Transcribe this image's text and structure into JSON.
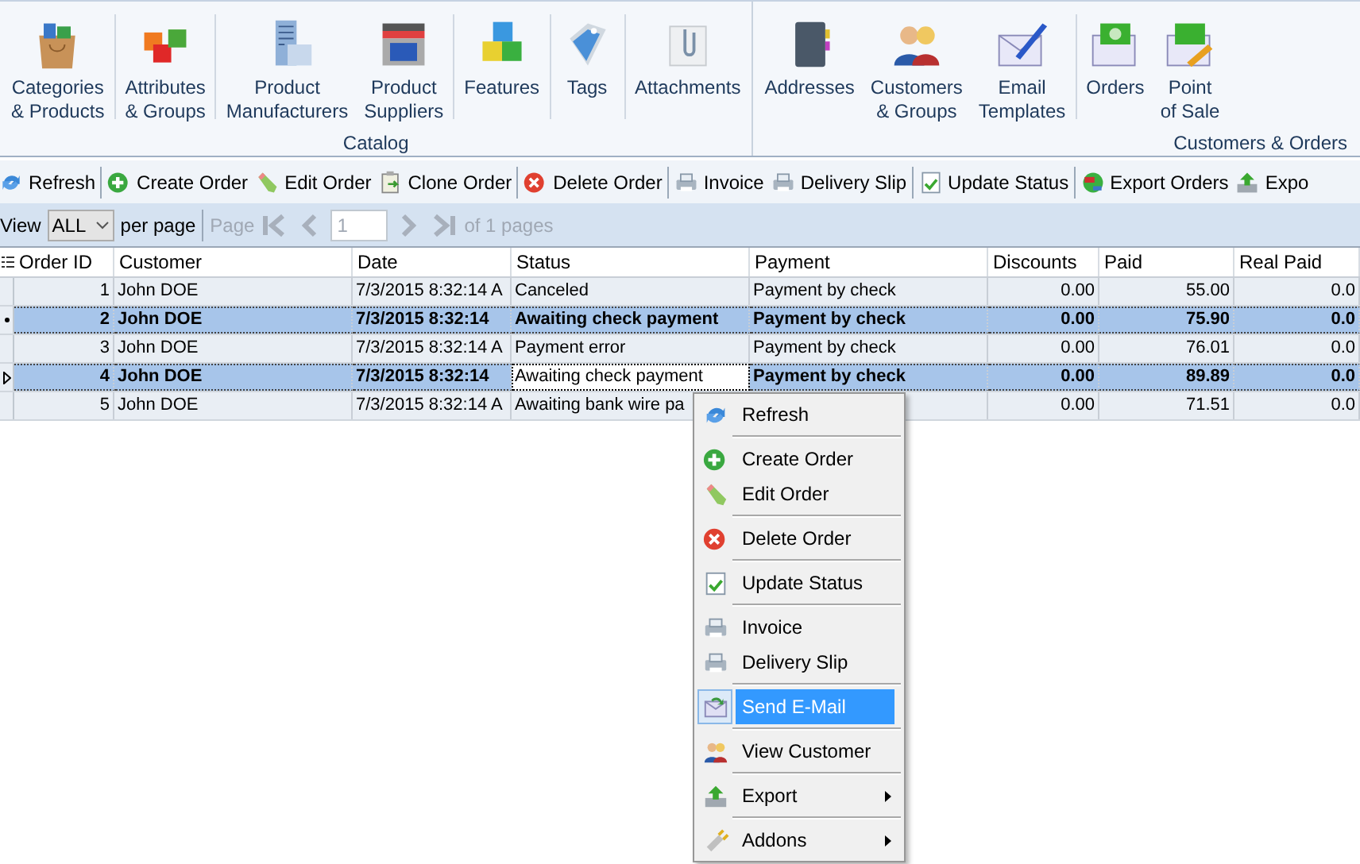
{
  "ribbon": {
    "groups": [
      {
        "label": "Catalog",
        "sections": [
          [
            {
              "lines": [
                "Categories",
                "& Products"
              ]
            }
          ],
          [
            {
              "lines": [
                "Attributes",
                "& Groups"
              ]
            }
          ],
          [
            {
              "lines": [
                "Product",
                "Manufacturers"
              ]
            },
            {
              "lines": [
                "Product",
                "Suppliers"
              ]
            }
          ],
          [
            {
              "lines": [
                "Features"
              ]
            }
          ],
          [
            {
              "lines": [
                "Tags"
              ]
            }
          ],
          [
            {
              "lines": [
                "Attachments"
              ]
            }
          ]
        ]
      },
      {
        "label": "Customers & Orders",
        "sections": [
          [
            {
              "lines": [
                "Addresses"
              ]
            },
            {
              "lines": [
                "Customers",
                "& Groups"
              ]
            },
            {
              "lines": [
                "Email",
                "Templates"
              ]
            }
          ],
          [
            {
              "lines": [
                "Orders"
              ]
            },
            {
              "lines": [
                "Point",
                "of Sale"
              ]
            }
          ]
        ]
      }
    ]
  },
  "toolbar": {
    "sections": [
      [
        "Refresh"
      ],
      [
        "Create Order",
        "Edit Order",
        "Clone Order"
      ],
      [
        "Delete Order"
      ],
      [
        "Invoice",
        "Delivery Slip"
      ],
      [
        "Update Status"
      ],
      [
        "Export Orders",
        "Expo"
      ]
    ]
  },
  "pager": {
    "view_label": "View",
    "per_page": "ALL",
    "per_page_label": "per page",
    "page_label": "Page",
    "page": "1",
    "of_pages": "of 1 pages"
  },
  "table": {
    "columns": [
      "Order ID",
      "Customer",
      "Date",
      "Status",
      "Payment",
      "Discounts",
      "Paid",
      "Real Paid"
    ],
    "rows": [
      {
        "selected": false,
        "focused": false,
        "marked": false,
        "current": false,
        "cells": [
          "1",
          "John DOE",
          "7/3/2015 8:32:14 A",
          "Canceled",
          "Payment by check",
          "0.00",
          "55.00",
          "0.0"
        ]
      },
      {
        "selected": true,
        "focused": false,
        "marked": true,
        "current": false,
        "cells": [
          "2",
          "John DOE",
          "7/3/2015 8:32:14",
          "Awaiting check payment",
          "Payment by check",
          "0.00",
          "75.90",
          "0.0"
        ]
      },
      {
        "selected": false,
        "focused": false,
        "marked": false,
        "current": false,
        "cells": [
          "3",
          "John DOE",
          "7/3/2015 8:32:14 A",
          "Payment error",
          "Payment by check",
          "0.00",
          "76.01",
          "0.0"
        ]
      },
      {
        "selected": true,
        "focused": true,
        "marked": false,
        "current": true,
        "cells": [
          "4",
          "John DOE",
          "7/3/2015 8:32:14",
          "Awaiting check payment",
          "Payment by check",
          "0.00",
          "89.89",
          "0.0"
        ]
      },
      {
        "selected": false,
        "focused": false,
        "marked": false,
        "current": false,
        "cells": [
          "5",
          "John DOE",
          "7/3/2015 8:32:14 A",
          "Awaiting bank wire pa",
          "",
          "0.00",
          "71.51",
          "0.0"
        ]
      }
    ]
  },
  "context_menu": {
    "sections": [
      [
        {
          "label": "Refresh",
          "selected": false
        }
      ],
      [
        {
          "label": "Create Order",
          "selected": false
        },
        {
          "label": "Edit Order",
          "selected": false
        }
      ],
      [
        {
          "label": "Delete Order",
          "selected": false
        }
      ],
      [
        {
          "label": "Update Status",
          "selected": false
        }
      ],
      [
        {
          "label": "Invoice",
          "selected": false
        },
        {
          "label": "Delivery Slip",
          "selected": false
        }
      ],
      [
        {
          "label": "Send E-Mail",
          "selected": true
        }
      ],
      [
        {
          "label": "View Customer",
          "selected": false
        }
      ],
      [
        {
          "label": "Export",
          "selected": false,
          "submenu": true
        }
      ],
      [
        {
          "label": "Addons",
          "selected": false,
          "submenu": true
        }
      ]
    ]
  }
}
